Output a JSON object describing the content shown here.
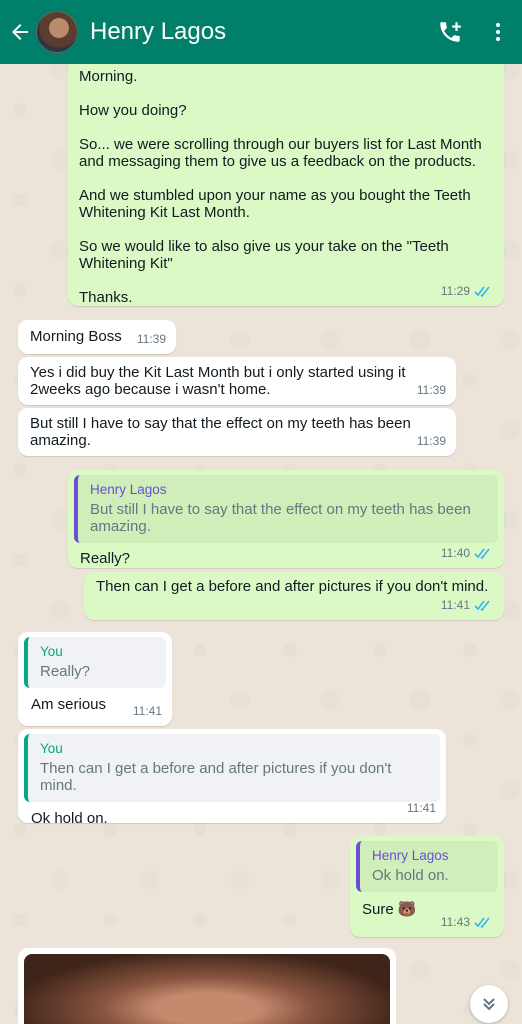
{
  "header": {
    "contact_name": "Henry Lagos",
    "icons": [
      "back-arrow-icon",
      "add-call-icon",
      "more-options-icon"
    ]
  },
  "messages": {
    "m1": {
      "text": "Morning.\n\nHow you doing?\n\nSo... we were scrolling through our buyers list for Last Month and messaging them to give us a feedback on the products.\n\nAnd we stumbled upon your name as you bought the Teeth Whitening Kit Last Month.\n\nSo we would like to also give us your take on the \"Teeth Whitening Kit\"\n\nThanks.",
      "time": "11:29"
    },
    "m2": {
      "text": "Morning Boss",
      "time": "11:39"
    },
    "m3": {
      "text": "Yes i did buy the Kit Last Month but i only started using it 2weeks ago because i wasn't home.",
      "time": "11:39"
    },
    "m4": {
      "text": "But still I have to say that the effect on my teeth has been amazing.",
      "time": "11:39"
    },
    "m5": {
      "quote_name": "Henry Lagos",
      "quote_text": "But still I have to say that the effect on my teeth has been amazing.",
      "text": "Really?",
      "time": "11:40"
    },
    "m6": {
      "text": "Then can I get a before and after pictures if you don't mind.",
      "time": "11:41"
    },
    "m7": {
      "quote_name": "You",
      "quote_text": "Really?",
      "text": "Am serious",
      "time": "11:41"
    },
    "m8": {
      "quote_name": "You",
      "quote_text": "Then can I get a before and after pictures if you don't mind.",
      "text": "Ok hold on.",
      "time": "11:41"
    },
    "m9": {
      "quote_name": "Henry Lagos",
      "quote_text": "Ok hold on.",
      "text": "Sure 🐻",
      "time": "11:43"
    }
  },
  "colors": {
    "header": "#00806a",
    "outgoing_bubble": "#dbf9c5",
    "incoming_bubble": "#ffffff",
    "read_ticks": "#34b7f1"
  }
}
